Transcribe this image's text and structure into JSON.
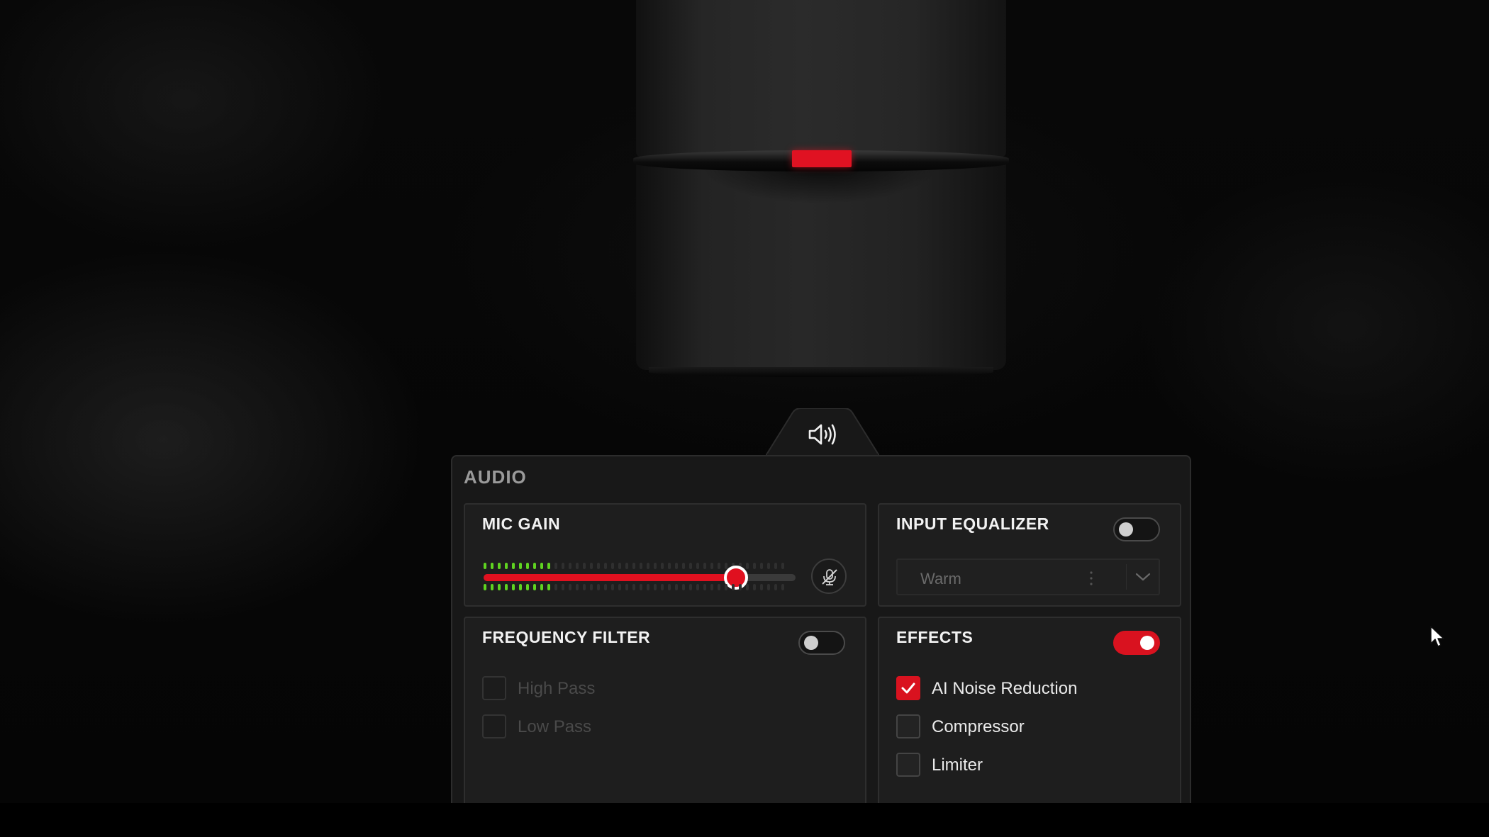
{
  "panel": {
    "title": "AUDIO",
    "tab_icon": "speaker-icon"
  },
  "mic_gain": {
    "title": "MIC GAIN",
    "level": 0.81,
    "meter_lit_segments": 10,
    "meter_total_segments": 43,
    "mute_icon": "mic-muted-icon"
  },
  "input_equalizer": {
    "title": "INPUT EQUALIZER",
    "enabled": false,
    "preset": "Warm"
  },
  "frequency_filter": {
    "title": "FREQUENCY FILTER",
    "enabled": false,
    "options": [
      {
        "label": "High Pass",
        "checked": false
      },
      {
        "label": "Low Pass",
        "checked": false
      }
    ]
  },
  "effects": {
    "title": "EFFECTS",
    "enabled": true,
    "options": [
      {
        "label": "AI Noise Reduction",
        "checked": true
      },
      {
        "label": "Compressor",
        "checked": false
      },
      {
        "label": "Limiter",
        "checked": false
      }
    ]
  },
  "colors": {
    "accent": "#d9121f",
    "meter_green": "#5fd320",
    "panel_bg": "#181818"
  }
}
